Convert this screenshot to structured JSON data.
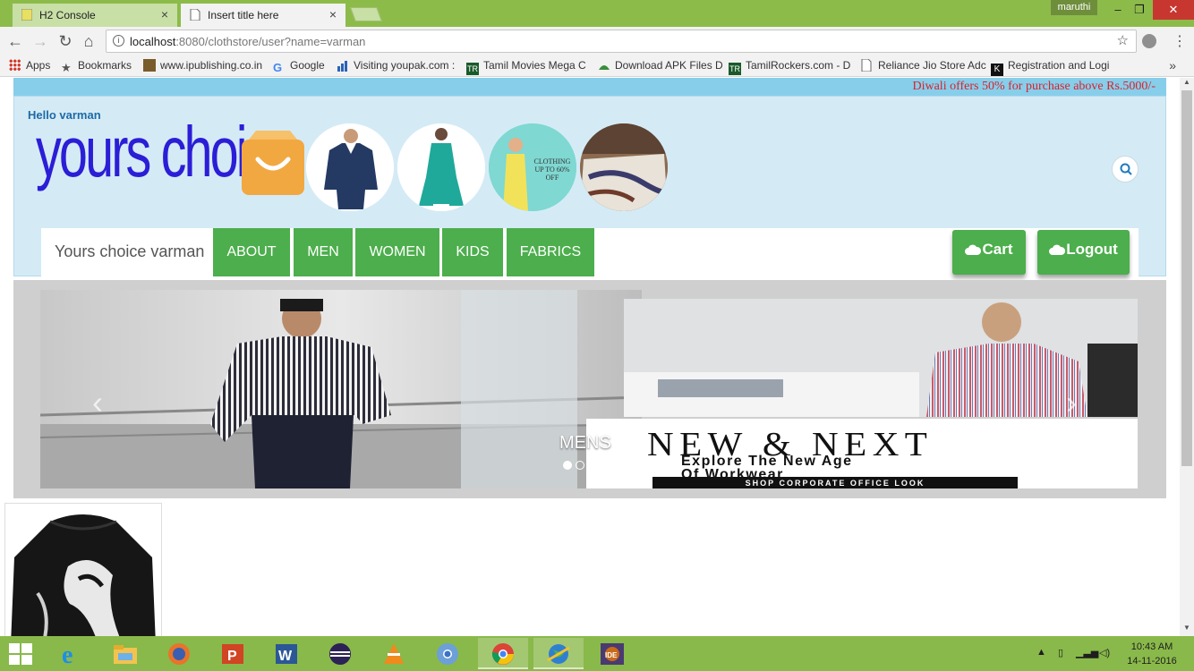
{
  "browser": {
    "tabs": [
      {
        "label": "H2 Console",
        "active": false
      },
      {
        "label": "Insert title here",
        "active": true
      }
    ],
    "user_chip": "maruthi",
    "url_host": "localhost",
    "url_rest": ":8080/clothstore/user?name=varman",
    "bookmarks": [
      {
        "label": "Apps",
        "icon": "apps-grid-icon"
      },
      {
        "label": "Bookmarks",
        "icon": "star-icon"
      },
      {
        "label": "www.ipublishing.co.in",
        "icon": "site-icon"
      },
      {
        "label": "Google",
        "icon": "google-icon"
      },
      {
        "label": "Visiting youpak.com :",
        "icon": "chart-icon"
      },
      {
        "label": "Tamil Movies Mega C",
        "icon": "tr-icon"
      },
      {
        "label": "Download APK Files D",
        "icon": "android-icon"
      },
      {
        "label": "TamilRockers.com - D",
        "icon": "tr-icon"
      },
      {
        "label": "Reliance Jio Store Adc",
        "icon": "page-icon"
      },
      {
        "label": "Registration and Logi",
        "icon": "k-icon"
      }
    ]
  },
  "page": {
    "offer_text": "Diwali offers 50% for purchase above Rs.5000/-",
    "greeting": "Hello varman",
    "logo": "yours choice",
    "category_circles": [
      {
        "name": "mens-shirt",
        "label": ""
      },
      {
        "name": "womens-kurti",
        "label": ""
      },
      {
        "name": "kids-clothing",
        "label": "CLOTHING UP TO 60% OFF"
      },
      {
        "name": "fabrics-bedsheet",
        "label": ""
      }
    ],
    "nav": {
      "brand": "Yours choice varman",
      "items": [
        "ABOUT",
        "MEN",
        "WOMEN",
        "KIDS",
        "FABRICS"
      ],
      "cart_label": "Cart",
      "logout_label": "Logout"
    },
    "carousel": {
      "caption": "MENS",
      "promo_title": "NEW & NEXT",
      "promo_line1": "Explore The New Age",
      "promo_line2": "Of Workwear",
      "promo_band": "SHOP CORPORATE OFFICE LOOK",
      "slide_count": 4,
      "active_index": 0
    }
  },
  "taskbar": {
    "apps": [
      {
        "name": "internet-explorer-icon",
        "active": false
      },
      {
        "name": "file-explorer-icon",
        "active": false
      },
      {
        "name": "firefox-icon",
        "active": false
      },
      {
        "name": "powerpoint-icon",
        "active": false
      },
      {
        "name": "word-icon",
        "active": false
      },
      {
        "name": "eclipse-icon",
        "active": false
      },
      {
        "name": "vlc-icon",
        "active": false
      },
      {
        "name": "chromium-icon",
        "active": false
      },
      {
        "name": "chrome-icon",
        "active": true
      },
      {
        "name": "network-globe-icon",
        "active": true
      },
      {
        "name": "java-ee-ide-icon",
        "active": false
      }
    ],
    "time": "10:43 AM",
    "date": "14-11-2016"
  },
  "colors": {
    "titlebar": "#8dbb4a",
    "nav_green": "#4cae4c",
    "header_bg": "#d4ebf6",
    "offer_bar": "#87ceeb",
    "offer_text": "#d8232a",
    "logo_blue": "#2b1ed6"
  }
}
